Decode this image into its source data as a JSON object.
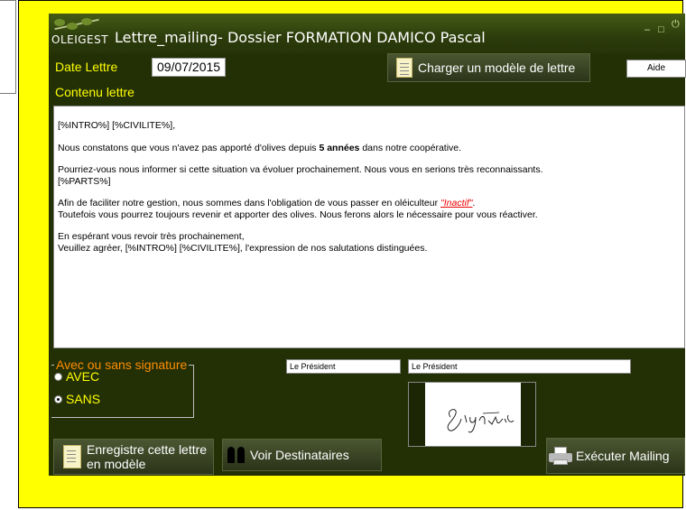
{
  "window": {
    "brand": "OLEIGEST",
    "title": "Lettre_mailing- Dossier FORMATION   DAMICO Pascal",
    "controls": {
      "minimize": "–",
      "maximize": "□",
      "power": "⏻"
    }
  },
  "header": {
    "date_label": "Date Lettre",
    "date_value": "09/07/2015",
    "load_template_label": "Charger un modèle de lettre",
    "help_label": "Aide",
    "content_label": "Contenu lettre"
  },
  "letter": {
    "p1": "[%INTRO%] [%CIVILITE%],",
    "p2_before": "Nous constatons que vous n'avez pas apporté d'olives depuis ",
    "p2_bold": "5 années",
    "p2_after": " dans notre coopérative.",
    "p3_line1": "Pourriez-vous nous informer si cette situation va évoluer prochainement. Nous vous en serions très reconnaissants.",
    "p3_line2": "[%PARTS%]",
    "p4_line1_before": "Afin de faciliter notre gestion, nous sommes dans l'obligation de vous passer en oléiculteur ",
    "p4_red": "\"Inactif\"",
    "p4_line1_after": ".",
    "p4_line2": "Toutefois vous pourrez toujours revenir et apporter des olives. Nous ferons alors le nécessaire pour vous réactiver.",
    "p5_line1": "En espérant vous revoir très prochainement,",
    "p5_line2": "Veuillez agréer, [%INTRO%] [%CIVILITE%], l'expression de nos salutations distinguées."
  },
  "signature": {
    "group_label": "Avec ou sans signature",
    "option_avec": "AVEC",
    "option_sans": "SANS",
    "selected": "SANS",
    "field1": "Le Président",
    "field2": "Le Président"
  },
  "footer": {
    "save_template_label_1": "Enregistre cette lettre",
    "save_template_label_2": "en modèle",
    "recipients_label": "Voir Destinataires",
    "execute_label": "Exécuter Mailing"
  },
  "colors": {
    "app_bg": "#233006",
    "outer": "#ffff00",
    "label": "#ffff00",
    "legend": "#ff8c00"
  }
}
